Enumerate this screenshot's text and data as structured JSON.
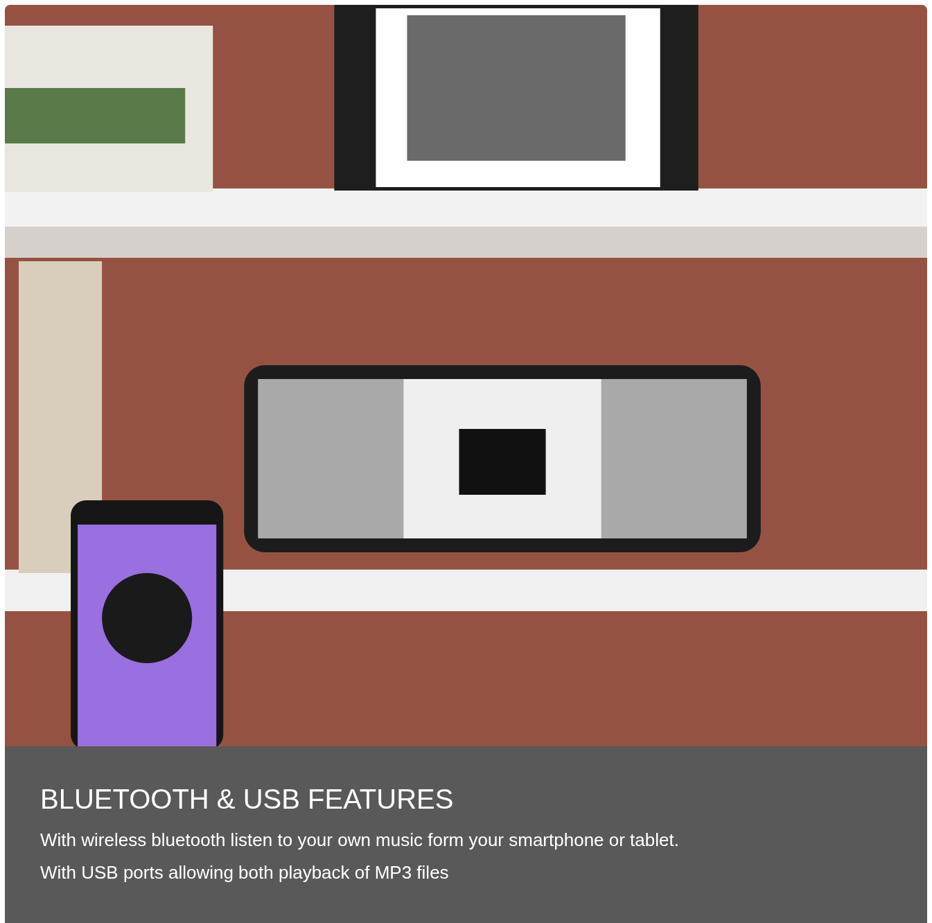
{
  "caption": {
    "title": "BLUETOOTH & USB FEATURES",
    "lines": [
      "With wireless bluetooth listen to your own music form your smartphone or tablet.",
      "With USB ports allowing both playback of MP3 files"
    ]
  }
}
